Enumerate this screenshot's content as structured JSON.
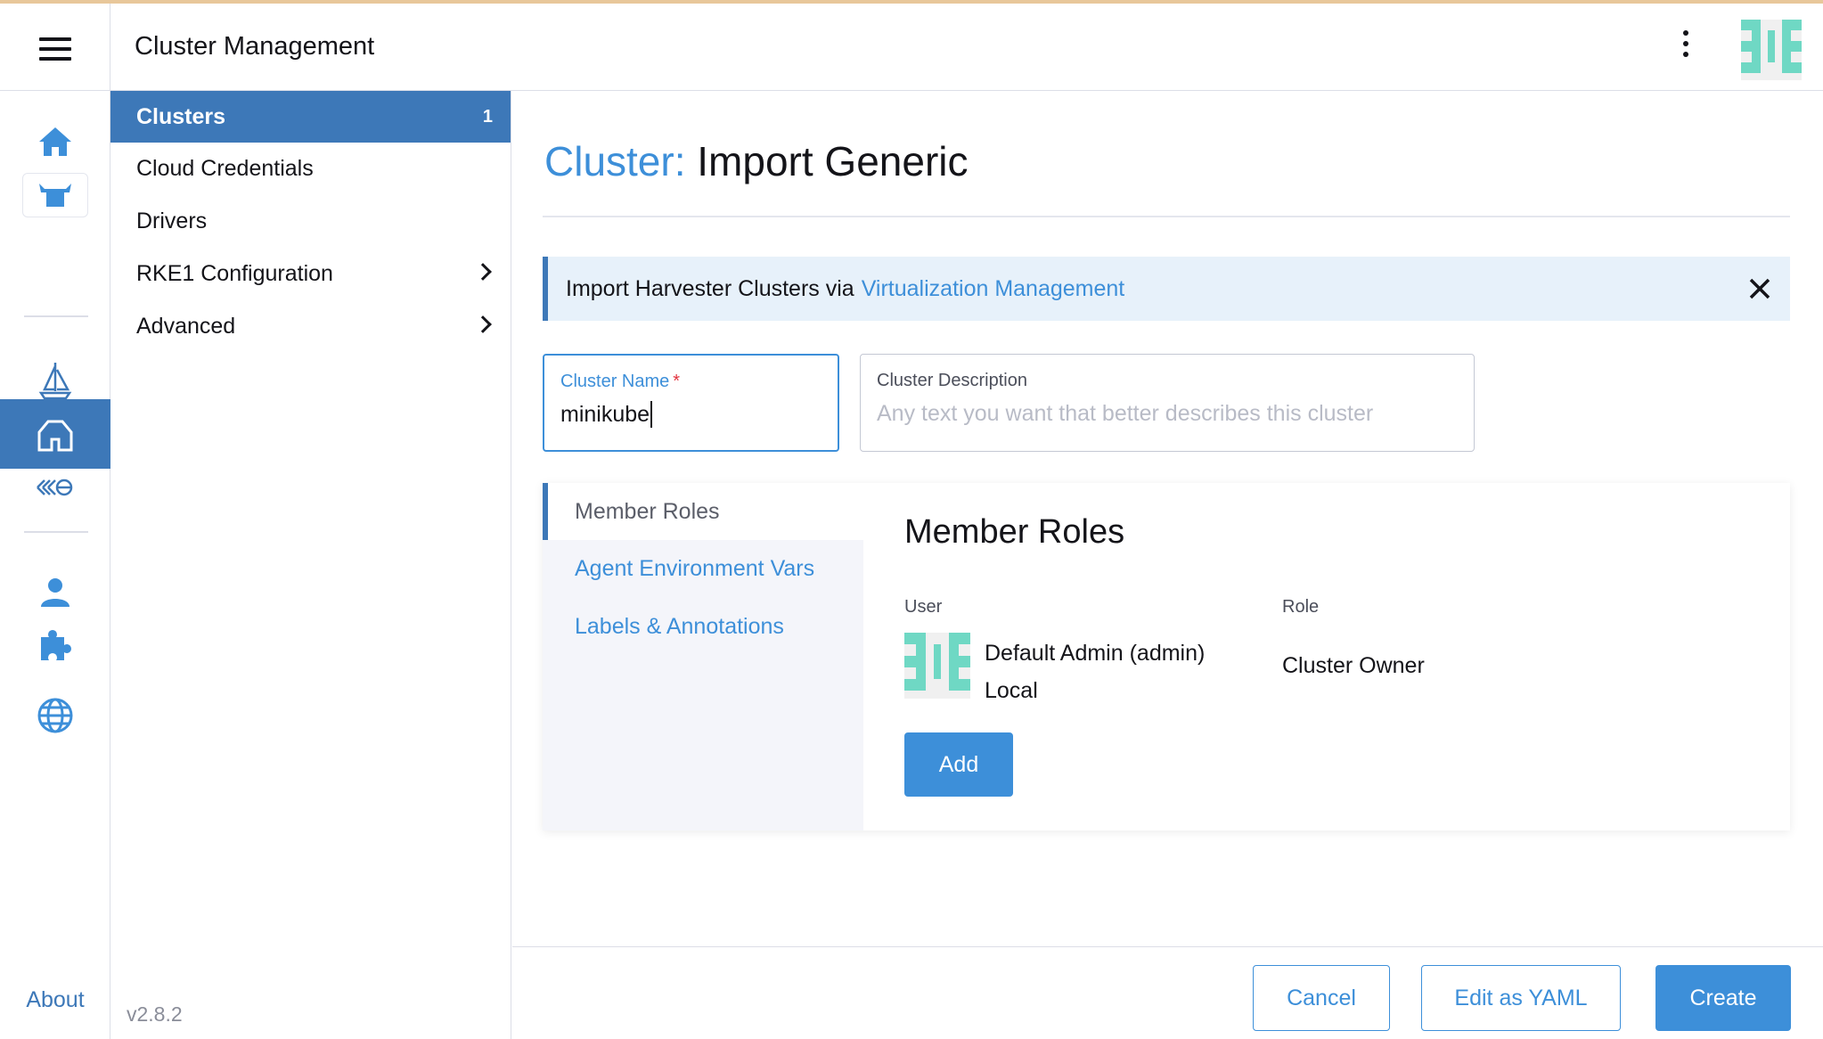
{
  "header": {
    "title": "Cluster Management"
  },
  "rail": {
    "icons": [
      "home-icon",
      "cow-icon",
      "sailboat-icon",
      "barn-icon",
      "fleet-icon",
      "user-icon",
      "puzzle-icon",
      "globe-icon"
    ],
    "about": "About",
    "accent": "#3d78b8"
  },
  "sidenav": {
    "items": [
      {
        "label": "Clusters",
        "count": "1"
      },
      {
        "label": "Cloud Credentials"
      },
      {
        "label": "Drivers"
      },
      {
        "label": "RKE1 Configuration"
      },
      {
        "label": "Advanced"
      }
    ],
    "version": "v2.8.2"
  },
  "page": {
    "title_prefix": "Cluster:",
    "title": "Import Generic"
  },
  "banner": {
    "text": "Import Harvester Clusters via",
    "link": "Virtualization Management"
  },
  "form": {
    "name": {
      "label": "Cluster Name",
      "required": "*",
      "value": "minikube"
    },
    "description": {
      "label": "Cluster Description",
      "placeholder": "Any text you want that better describes this cluster"
    }
  },
  "tabs": [
    {
      "label": "Member Roles"
    },
    {
      "label": "Agent Environment Vars"
    },
    {
      "label": "Labels & Annotations"
    }
  ],
  "member_roles": {
    "title": "Member Roles",
    "user_header": "User",
    "role_header": "Role",
    "user_name": "Default Admin (admin)",
    "user_provider": "Local",
    "role": "Cluster Owner",
    "add_label": "Add"
  },
  "footer": {
    "cancel": "Cancel",
    "edit_yaml": "Edit as YAML",
    "create": "Create"
  }
}
